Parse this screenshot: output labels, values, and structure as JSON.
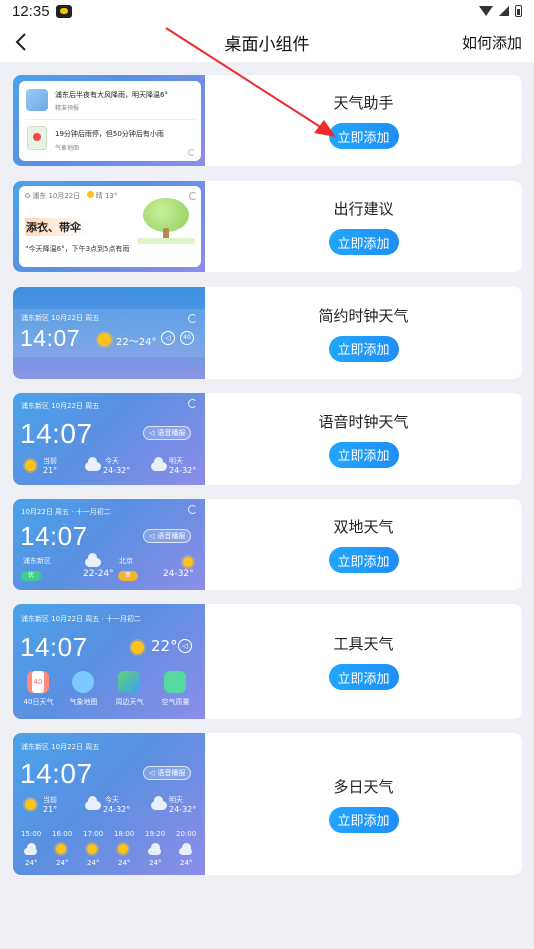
{
  "status": {
    "time": "12:35"
  },
  "nav": {
    "title": "桌面小组件",
    "how": "如何添加"
  },
  "add_label": "立即添加",
  "widgets": [
    {
      "name": "天气助手",
      "line1": "浦东后半夜有大风降雨，明天降温6°",
      "line1_sub": "精准预报",
      "line2": "19分钟后雨停，但50分钟后有小雨",
      "line2_sub": "气象地图"
    },
    {
      "name": "出行建议",
      "loc": "浦东 10月22日",
      "weather": "晴 13°",
      "headline": "添衣、带伞",
      "quote": "“今天降温6°，下午3点到5点有雨"
    },
    {
      "name": "简约时钟天气",
      "loc": "浦东新区  10月22日  周五",
      "time": "14:07",
      "temp": "22～24°",
      "aqi": "40"
    },
    {
      "name": "语音时钟天气",
      "loc": "浦东新区  10月22日  周五",
      "time": "14:07",
      "voice": "语音播报",
      "cols": [
        {
          "label": "当前",
          "value": "21°"
        },
        {
          "label": "今天",
          "value": "24-32°"
        },
        {
          "label": "明天",
          "value": "24-32°"
        }
      ]
    },
    {
      "name": "双地天气",
      "date": "10月22日  周五 · 十一月初二",
      "time": "14:07",
      "voice": "语音播报",
      "city1": "浦东新区",
      "city1_badge": "优",
      "city1_temp": "22-24°",
      "city2": "北京",
      "city2_badge": "良",
      "city2_temp": "24-32°"
    },
    {
      "name": "工具天气",
      "loc": "浦东新区  10月22日  周五 · 十一月初二",
      "time": "14:07",
      "temp": "22°",
      "tool_40_num": "40",
      "tools": [
        "40日天气",
        "气象地图",
        "周边天气",
        "空气质量"
      ]
    },
    {
      "name": "多日天气",
      "loc": "浦东新区  10月22日  周五",
      "time": "14:07",
      "voice": "语音播报",
      "cols": [
        {
          "label": "当前",
          "value": "21°"
        },
        {
          "label": "今天",
          "value": "24-32°"
        },
        {
          "label": "明天",
          "value": "24-32°"
        }
      ],
      "hours": [
        "15:00",
        "16:00",
        "17:00",
        "18:00",
        "19:20",
        "20:00"
      ],
      "hour_temps": [
        "24°",
        "24°",
        "24°",
        "24°",
        "24°",
        "24°"
      ]
    }
  ]
}
